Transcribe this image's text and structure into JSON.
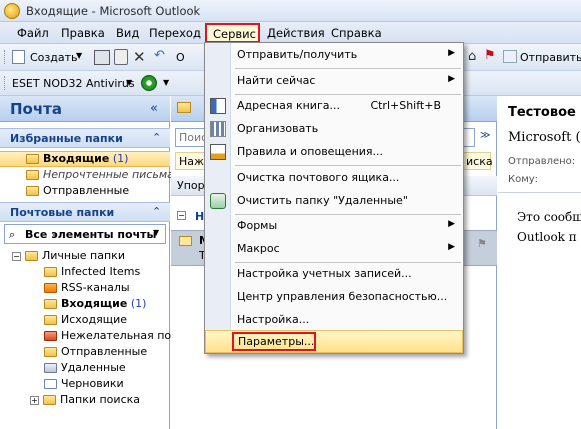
{
  "window": {
    "title": "Входящие - Microsoft Outlook"
  },
  "menubar": {
    "items": [
      "Файл",
      "Правка",
      "Вид",
      "Переход",
      "Сервис",
      "Действия",
      "Справка"
    ]
  },
  "toolbar": {
    "create": "Создать",
    "reply_partial": "О",
    "send": "Отправить"
  },
  "toolbar2": {
    "antivirus": "ESET NOD32 Antivirus"
  },
  "navigation": {
    "header": "Почта",
    "collapse_glyph": "«",
    "favorites_title": "Избранные папки",
    "favorites": [
      {
        "label": "Входящие",
        "count": "(1)",
        "bold": true
      },
      {
        "label": "Непрочтенные письма",
        "italic": true
      },
      {
        "label": "Отправленные"
      }
    ],
    "mail_folders_title": "Почтовые папки",
    "all_items": "Все элементы почты",
    "tree_root": "Личные папки",
    "tree": [
      {
        "label": "Infected Items"
      },
      {
        "label": "RSS-каналы"
      },
      {
        "label": "Входящие",
        "count": "(1)",
        "bold": true
      },
      {
        "label": "Исходящие"
      },
      {
        "label": "Нежелательная поч"
      },
      {
        "label": "Отправленные"
      },
      {
        "label": "Удаленные"
      },
      {
        "label": "Черновики"
      },
      {
        "label": "Папки поиска"
      }
    ]
  },
  "middle": {
    "search_partial": "Поис",
    "prompt_partial": "Наж",
    "prompt_right": "иска",
    "arrange_partial": "Упор",
    "group_partial": "Н",
    "item_initial": "М",
    "item_second": "Т"
  },
  "reading": {
    "subject": "Тестовое",
    "from": "Microsoft (",
    "sent_label": "Отправлено:",
    "to_label": "Кому:",
    "body_line1": "Это сообщ",
    "body_line2": "Outlook п"
  },
  "dropdown": {
    "items": [
      {
        "label": "Отправить/получить",
        "submenu": true
      },
      {
        "label": "Найти сейчас",
        "submenu": true
      },
      {
        "label": "Адресная книга...",
        "shortcut": "Ctrl+Shift+B",
        "icon": "address-book-icon"
      },
      {
        "label": "Организовать",
        "icon": "organize-icon"
      },
      {
        "label": "Правила и оповещения...",
        "icon": "rules-icon"
      },
      {
        "label": "Очистка почтового ящика..."
      },
      {
        "label": "Очистить папку \"Удаленные\"",
        "icon": "recycle-icon"
      },
      {
        "label": "Формы",
        "submenu": true
      },
      {
        "label": "Макрос",
        "submenu": true
      },
      {
        "label": "Настройка учетных записей..."
      },
      {
        "label": "Центр управления безопасностью..."
      },
      {
        "label": "Настройка..."
      },
      {
        "label": "Параметры...",
        "highlighted": true
      }
    ]
  },
  "colors": {
    "highlight": "#ffe28a",
    "annotation_red": "#e0141e",
    "nav_header": "#15428b"
  }
}
